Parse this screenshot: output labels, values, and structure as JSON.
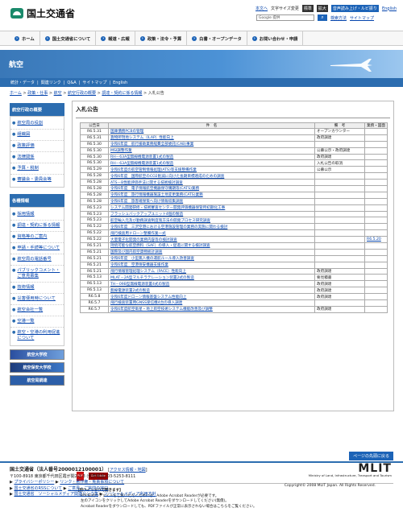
{
  "header": {
    "site_name": "国土交通省",
    "util_links": [
      "本文へ",
      "文字サイズ変更",
      "標準",
      "拡大",
      "音声読み上げ・ルビ振り",
      "English"
    ],
    "search_placeholder": "Google 提供",
    "search_links": [
      "検索方法",
      "サイトマップ"
    ]
  },
  "nav": [
    {
      "label": "ホーム"
    },
    {
      "label": "国土交通省について"
    },
    {
      "label": "報道・広報"
    },
    {
      "label": "政策・法令・予算"
    },
    {
      "label": "白書・オープンデータ"
    },
    {
      "label": "お問い合わせ・申請"
    }
  ],
  "banner": {
    "title": "航空"
  },
  "subnav": [
    "統計・データ",
    "関連リンク",
    "Q&A",
    "サイトマップ",
    "English"
  ],
  "breadcrumb": [
    "ホーム",
    "政策・仕事",
    "航空",
    "航空行政の概要",
    "調達・契約に係る情報",
    "入札公告"
  ],
  "sidebar": {
    "section1_title": "航空行政の概要",
    "section1_items": [
      "航空局の役割",
      "組織図",
      "政策評価",
      "法律関係",
      "予算・税制",
      "審議会・委員会等"
    ],
    "section2_title": "各種情報",
    "section2_items": [
      "採用情報",
      "調達・契約に係る情報",
      "資格等のご案内",
      "申請・手続等について",
      "航空局の電話番号",
      "パブリックコメント・ご意見募集",
      "技術情報",
      "災害便用時について",
      "航空会社一覧",
      "空港一覧",
      "航空・空港の利用促進について"
    ],
    "ads": [
      "航空大学校",
      "航空保安大学校",
      "航空局調達"
    ]
  },
  "main": {
    "title": "入札公告",
    "headers": [
      "公告日",
      "件　名",
      "備　考",
      "業務・図面"
    ],
    "rows": [
      {
        "date": "R6.5.31",
        "title": "国庫債務PCBの管理",
        "note": "オープンカウンター",
        "att": ""
      },
      {
        "date": "R6.5.31",
        "title": "貨物所現地システム（ILAP）性能向上",
        "note": "政府調達",
        "att": ""
      },
      {
        "date": "R6.5.30",
        "title": "令和6年度　航行援助業務経費全部委託(CAB)事業",
        "note": "",
        "att": ""
      },
      {
        "date": "R6.5.30",
        "title": "MSI調整作業",
        "note": "公募公示・政府調達",
        "att": ""
      },
      {
        "date": "R6.5.30",
        "title": "RH－63A型無線機電源装置1式の製造",
        "note": "政府調達",
        "att": ""
      },
      {
        "date": "R6.5.30",
        "title": "RH－63A型無線機電源装置1式の製造",
        "note": "入札公告の取消",
        "att": ""
      },
      {
        "date": "R6.5.29",
        "title": "令和6年度の航空管制情報処理(ATS)等支援整備作業",
        "note": "公募公示",
        "att": ""
      },
      {
        "date": "R6.5.28",
        "title": "令和6年度　国際航空のCO2削減に向けた長期目標達成のための調査",
        "note": "",
        "att": ""
      },
      {
        "date": "R6.5.28",
        "title": "ATS－B性能評価手法に関する技術検討調査",
        "note": "",
        "att": ""
      },
      {
        "date": "R6.5.28",
        "title": "令和6年度　電子情報航空機器保守購期等(CATS)業務",
        "note": "",
        "att": ""
      },
      {
        "date": "R6.5.28",
        "title": "令和6年度　旅行情報機器施設土地変更業務(CATS)業務",
        "note": "",
        "att": ""
      },
      {
        "date": "R6.5.28",
        "title": "令和6年度　旅客確保策へ向け情報収集調査",
        "note": "",
        "att": ""
      },
      {
        "date": "R6.5.23",
        "title": "システム開発研修・技術審査センター開発評価機器保管所初期化工事",
        "note": "",
        "att": ""
      },
      {
        "date": "R6.5.23",
        "title": "フラッシュバックアップユニット4個の製造",
        "note": "",
        "att": ""
      },
      {
        "date": "R6.5.23",
        "title": "航空輸入元及び勤務調査制度策方法の開発プロセス研究調査",
        "note": "",
        "att": ""
      },
      {
        "date": "R6.5.22",
        "title": "令和6年度　三沢空港における空港施設管理の業務の実施に関わる検討",
        "note": "",
        "att": ""
      },
      {
        "date": "R6.5.22",
        "title": "飛行検査用ドローン整備作業一式",
        "note": "",
        "att": ""
      },
      {
        "date": "R6.5.22",
        "title": "大量電子化開発の業務内容等の検討調査",
        "note": "",
        "att": "R6.5.20"
      },
      {
        "date": "R6.5.21",
        "title": "持続可能な航空燃料（SAF）の導入・促進に関する検討調査",
        "note": "",
        "att": ""
      },
      {
        "date": "R6.5.21",
        "title": "国際及び国内航空貨物統計調査",
        "note": "",
        "att": ""
      },
      {
        "date": "R6.5.21",
        "title": "令和6年度　小型無人機の運航ルール導入改善調査",
        "note": "",
        "att": ""
      },
      {
        "date": "R6.5.21",
        "title": "令和6年度　空港保安機器支援作業",
        "note": "",
        "att": ""
      },
      {
        "date": "R6.5.21",
        "title": "飛行情報管理処理システム（FACE）性能向上",
        "note": "政府調達",
        "att": ""
      },
      {
        "date": "R6.5.13",
        "title": "MLAT－2A型マルチラテレーション装置2式の製造",
        "note": "要見積書",
        "att": ""
      },
      {
        "date": "R6.5.13",
        "title": "TH－09B型無線電源装置4式の製造",
        "note": "政府調達",
        "att": ""
      },
      {
        "date": "R6.5.13",
        "title": "無線電源装置2式の製造",
        "note": "政府調達",
        "att": ""
      },
      {
        "date": "R6.5.8",
        "title": "令和6年度ドローン情報基盤システム性能向上",
        "note": "政府調達",
        "att": ""
      },
      {
        "date": "R6.5.7",
        "title": "飛行検査装置用GNSS受信機4台の導入調達",
        "note": "",
        "att": ""
      },
      {
        "date": "R6.5.7",
        "title": "令和6年度航空衛星・地上航空技術システム機能改善及び調整",
        "note": "政府調達",
        "att": ""
      }
    ],
    "pdf_icon": "PDF",
    "reader_badge": "Get Adobe Reader",
    "note_title": "【別ウインドウで開きます】",
    "note_lines": [
      "PDF形式のファイルをご覧いただくためには、Adobe Acrobat Readerが必要です。",
      "左のアイコンをクリックしてAdobe Acrobat Readerをダウンロードしてください(無償)。",
      "Acrobat Readerをダウンロードしても、PDFファイルが正常に表示されない場合はこちらをご覧ください。"
    ]
  },
  "page_top": "ページの先頭に戻る",
  "footer": {
    "org": "国土交通省（法人番号2000012100001）",
    "access": "アクセス情報・地図",
    "address": "〒100-8918 東京都千代田区霞が関2-1-3 (代表電話) 03-5253-8111",
    "links1": [
      "プライバシーポリシー",
      "リンク・著作権・免責事項について"
    ],
    "links2": [
      "国土交通省のRSSについて",
      "ご意見・ご質問の窓口"
    ],
    "links3": [
      "国土交通省　ソーシャルメディア関連リンク集",
      "ソーシャルメディア利用方針"
    ],
    "mlit_logo": "MLIT",
    "mlit_sub1": "Ministry of Land, Infrastructure, Transport and Tourism",
    "copyright": "Copyright© 2008 MLIT Japan. All Rights Reserved."
  }
}
